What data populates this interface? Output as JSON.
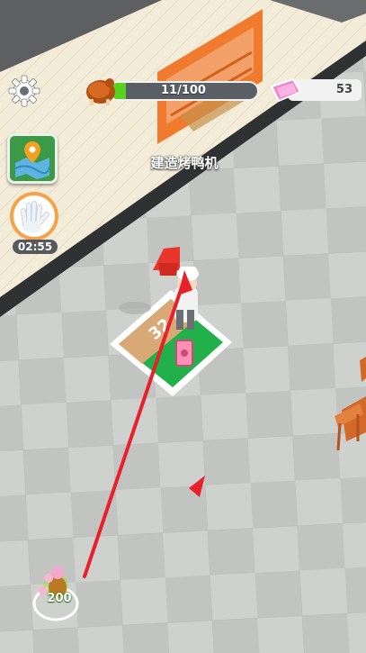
{
  "hud": {
    "duck_progress": {
      "text": "11/100",
      "fraction": 0.11,
      "icon": "roast-duck-icon"
    },
    "gems": {
      "value": "53",
      "icon": "pink-gem-icon"
    },
    "settings_icon": "gear-icon",
    "map_icon": "map-pin-icon",
    "glove": {
      "icon": "white-glove-icon",
      "timer": "02:55"
    }
  },
  "task": {
    "label": "建造烤鸭机"
  },
  "station": {
    "cost": "32",
    "icon": "pink-card-icon"
  },
  "coins": {
    "value": "200",
    "icon": "cash-bag-icon"
  },
  "colors": {
    "progress_fill": "#58d21e",
    "station_green": "#22b04a",
    "arrow": "#e8202a",
    "wall_orange": "#f07a2e",
    "floor_light": "#d3d5d3",
    "floor_dark": "#c3c5c3"
  }
}
